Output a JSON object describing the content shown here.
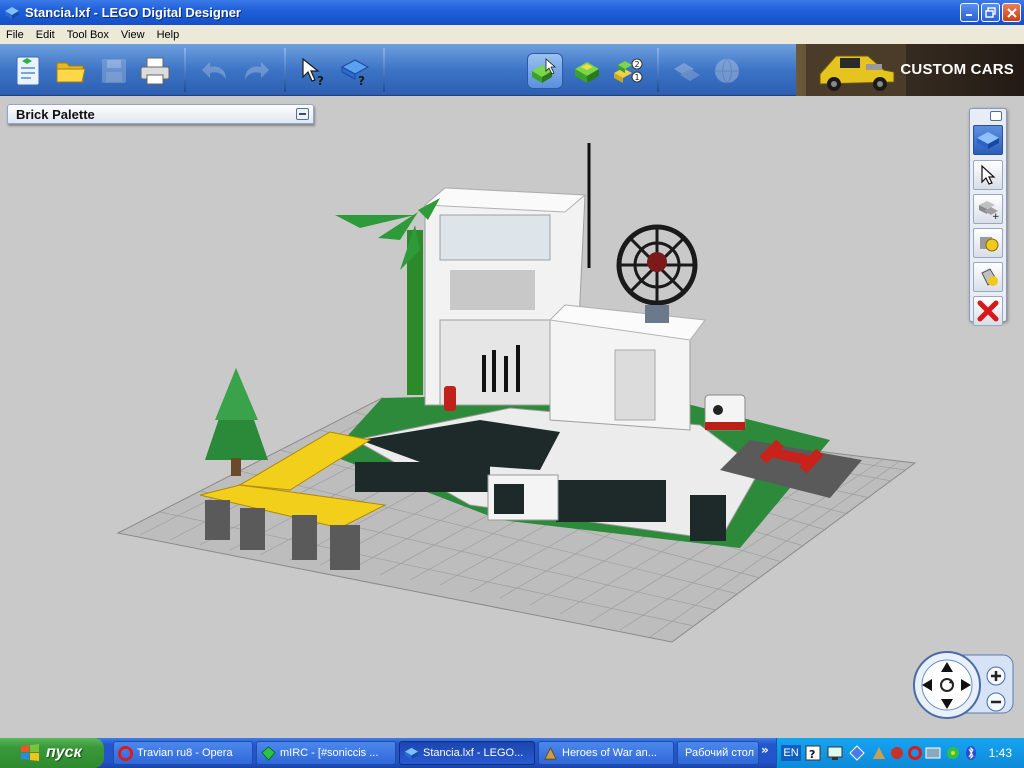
{
  "window": {
    "title": "Stancia.lxf - LEGO Digital Designer"
  },
  "menu": [
    "File",
    "Edit",
    "Tool Box",
    "View",
    "Help"
  ],
  "toolbar": {
    "banner_text": "CUSTOM CARS"
  },
  "palette": {
    "title": "Brick Palette"
  },
  "colors": {
    "titlebar": "#2060d8",
    "toolbar": "#3d74c6",
    "workspace": "#c9c9c9",
    "taskbar": "#2458d0",
    "start": "#3a9a3a"
  },
  "taskbar": {
    "start_label": "пуск",
    "tasks": [
      {
        "label": "Travian ru8 - Opera",
        "icon": "opera-icon"
      },
      {
        "label": "mIRC - [#soniccis ...",
        "icon": "mirc-icon"
      },
      {
        "label": "Stancia.lxf - LEGO...",
        "icon": "lego-icon"
      },
      {
        "label": "Heroes of War an...",
        "icon": "heroes-icon"
      },
      {
        "label": "Рабочий стол",
        "icon": ""
      }
    ],
    "lang": "EN",
    "clock": "1:43"
  }
}
